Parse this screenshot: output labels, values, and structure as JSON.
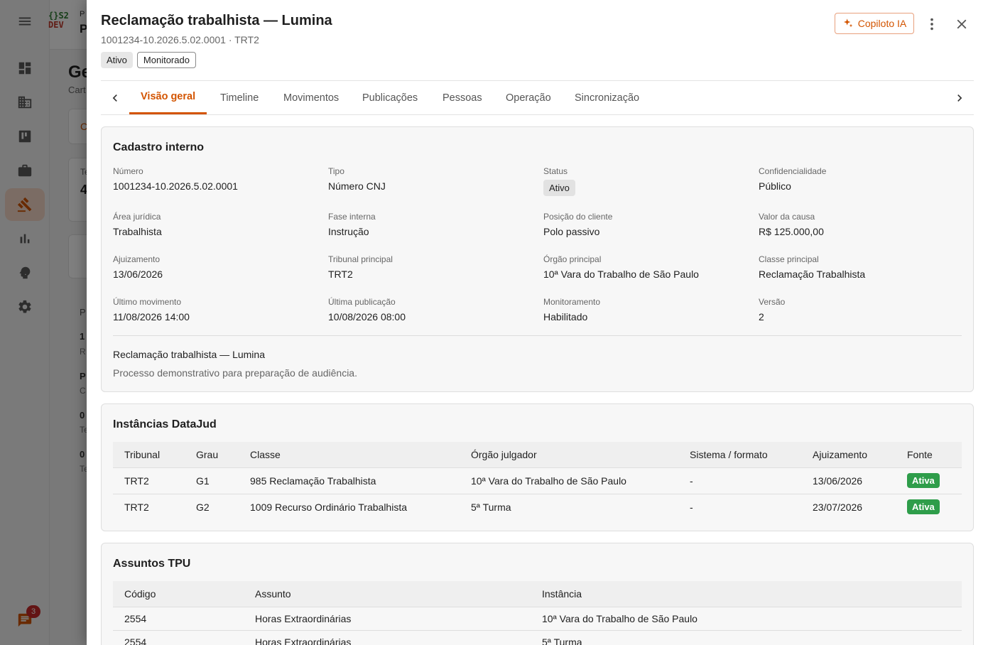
{
  "background": {
    "logo_top": "{}S2",
    "logo_bottom": "DEV",
    "app_p_small": "P",
    "app_p_big": "P",
    "page_title_fragment": "Ge",
    "page_subtitle_fragment": "Cart",
    "chat_badge_count": "3",
    "row_fragments": [
      {
        "title": "1",
        "sub": "R"
      },
      {
        "title": "P",
        "sub": "C"
      },
      {
        "title": "0",
        "sub": "Te"
      },
      {
        "title": "0",
        "sub": "Te"
      }
    ],
    "card_fragments": [
      "C",
      "Te",
      "4",
      "P"
    ]
  },
  "drawer": {
    "title": "Reclamação trabalhista — Lumina",
    "subtitle": "1001234-10.2026.5.02.0001 · TRT2",
    "chips": [
      "Ativo",
      "Monitorado"
    ],
    "copilot_label": "Copiloto IA",
    "tabs": [
      "Visão geral",
      "Timeline",
      "Movimentos",
      "Publicações",
      "Pessoas",
      "Operação",
      "Sincronização"
    ],
    "active_tab": "Visão geral"
  },
  "cadastro": {
    "title": "Cadastro interno",
    "fields": [
      {
        "label": "Número",
        "value": "1001234-10.2026.5.02.0001"
      },
      {
        "label": "Tipo",
        "value": "Número CNJ"
      },
      {
        "label": "Status",
        "value": "Ativo"
      },
      {
        "label": "Confidencialidade",
        "value": "Público"
      },
      {
        "label": "Área jurídica",
        "value": "Trabalhista"
      },
      {
        "label": "Fase interna",
        "value": "Instrução"
      },
      {
        "label": "Posição do cliente",
        "value": "Polo passivo"
      },
      {
        "label": "Valor da causa",
        "value": "R$ 125.000,00"
      },
      {
        "label": "Ajuizamento",
        "value": "13/06/2026"
      },
      {
        "label": "Tribunal principal",
        "value": "TRT2"
      },
      {
        "label": "Órgão principal",
        "value": "10ª Vara do Trabalho de São Paulo"
      },
      {
        "label": "Classe principal",
        "value": "Reclamação Trabalhista"
      },
      {
        "label": "Último movimento",
        "value": "11/08/2026 14:00"
      },
      {
        "label": "Última publicação",
        "value": "10/08/2026 08:00"
      },
      {
        "label": "Monitoramento",
        "value": "Habilitado"
      },
      {
        "label": "Versão",
        "value": "2"
      }
    ],
    "description_title": "Reclamação trabalhista — Lumina",
    "description_text": "Processo demonstrativo para preparação de audiência."
  },
  "datajud": {
    "title": "Instâncias DataJud",
    "columns": [
      "Tribunal",
      "Grau",
      "Classe",
      "Órgão julgador",
      "Sistema / formato",
      "Ajuizamento",
      "Fonte"
    ],
    "rows": [
      {
        "tribunal": "TRT2",
        "grau": "G1",
        "classe": "985 Reclamação Trabalhista",
        "orgao": "10ª Vara do Trabalho de São Paulo",
        "sistema": "-",
        "ajuizamento": "13/06/2026",
        "fonte": "Ativa"
      },
      {
        "tribunal": "TRT2",
        "grau": "G2",
        "classe": "1009 Recurso Ordinário Trabalhista",
        "orgao": "5ª Turma",
        "sistema": "-",
        "ajuizamento": "23/07/2026",
        "fonte": "Ativa"
      }
    ]
  },
  "assuntos": {
    "title": "Assuntos TPU",
    "columns": [
      "Código",
      "Assunto",
      "Instância"
    ],
    "rows": [
      {
        "codigo": "2554",
        "assunto": "Horas Extraordinárias",
        "instancia": "10ª Vara do Trabalho de São Paulo"
      },
      {
        "codigo": "2554",
        "assunto": "Horas Extraordinárias",
        "instancia": "5ª Turma"
      }
    ]
  },
  "colors": {
    "accent": "#d35400",
    "success": "#2e9d4a",
    "scrim": "rgba(0,0,0,0.5)"
  },
  "icons": {
    "rail": [
      "menu-icon",
      "dashboard-icon",
      "building-icon",
      "kanban-icon",
      "briefcase-icon",
      "gavel-icon",
      "bar-chart-icon",
      "brain-icon",
      "settings-icon",
      "chat-icon"
    ],
    "copilot": "sparkle-icon",
    "more": "more-vertical-icon",
    "close": "close-icon",
    "tab_prev": "chevron-left-icon",
    "tab_next": "chevron-right-icon"
  }
}
